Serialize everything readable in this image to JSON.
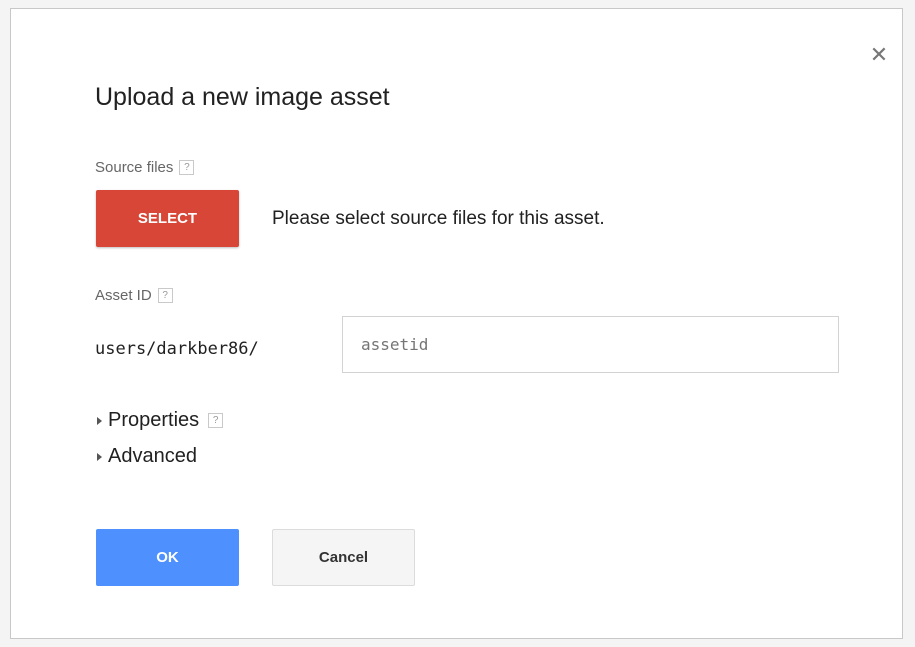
{
  "dialog": {
    "title": "Upload a new image asset",
    "close_glyph": "✕",
    "close_icon": "close-icon"
  },
  "source_files": {
    "label": "Source files",
    "help_glyph": "?",
    "select_label": "SELECT",
    "message": "Please select source files for this asset."
  },
  "asset_id": {
    "label": "Asset ID",
    "help_glyph": "?",
    "prefix": "users/darkber86/",
    "value": "",
    "placeholder": "assetid"
  },
  "sections": {
    "properties_label": "Properties",
    "properties_help_glyph": "?",
    "advanced_label": "Advanced",
    "expander_icon": "triangle-right-icon"
  },
  "actions": {
    "ok_label": "OK",
    "cancel_label": "Cancel"
  },
  "colors": {
    "select_button": "#d74637",
    "ok_button": "#4d90fe",
    "cancel_button": "#f5f5f5"
  }
}
